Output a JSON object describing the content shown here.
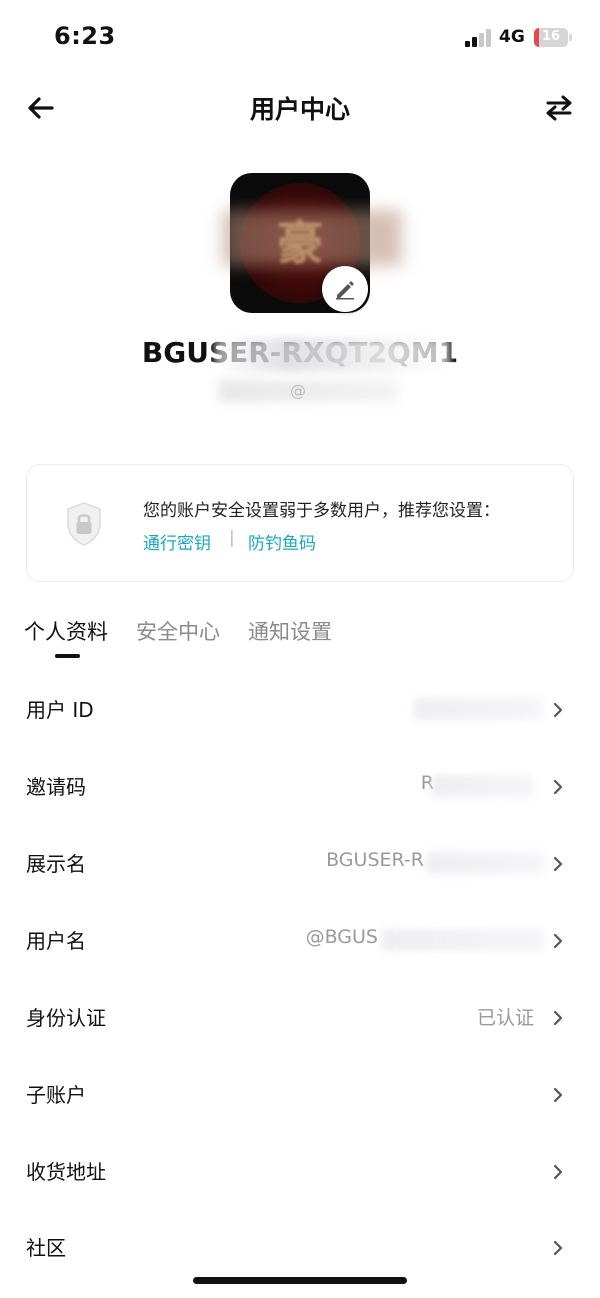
{
  "status_bar": {
    "time": "6:23",
    "network": "4G",
    "battery": "16",
    "battery_level": 0.16
  },
  "nav": {
    "title": "用户中心"
  },
  "profile": {
    "display_name": "BGUSER-RXQT2QM1",
    "email": "@"
  },
  "security": {
    "message": "您的账户安全设置弱于多数用户，推荐您设置：",
    "link_passkey": "通行密钥",
    "separator": "|",
    "link_antiphishing": "防钓鱼码"
  },
  "tabs": [
    "个人资料",
    "安全中心",
    "通知设置"
  ],
  "rows": [
    {
      "label": "用户 ID",
      "value": ""
    },
    {
      "label": "邀请码",
      "value": "R"
    },
    {
      "label": "展示名",
      "value": "BGUSER-R"
    },
    {
      "label": "用户名",
      "value": "@BGUS"
    },
    {
      "label": "身份认证",
      "value": "已认证"
    },
    {
      "label": "子账户",
      "value": ""
    },
    {
      "label": "收货地址",
      "value": ""
    },
    {
      "label": "社区",
      "value": ""
    }
  ],
  "icons": {
    "back": "arrow-left-icon",
    "switch": "swap-arrows-icon",
    "edit": "pencil-icon",
    "shield": "shield-lock-icon",
    "chevron": "chevron-right-icon"
  }
}
